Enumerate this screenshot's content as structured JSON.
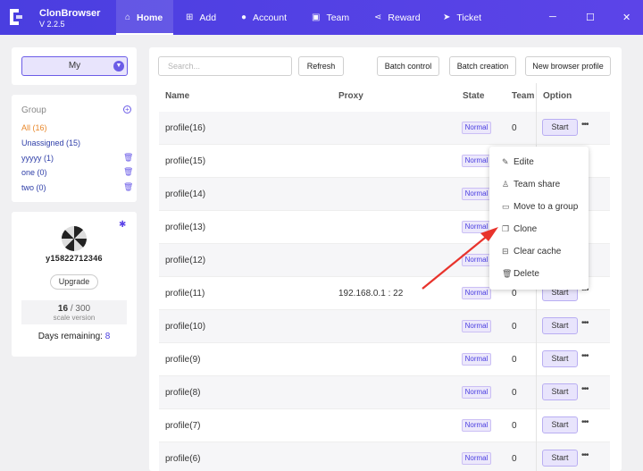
{
  "app": {
    "title": "ClonBrowser",
    "version": "V 2.2.5"
  },
  "nav": [
    {
      "label": "Home",
      "icon": "home-icon",
      "active": true
    },
    {
      "label": "Add",
      "icon": "plus-icon"
    },
    {
      "label": "Account",
      "icon": "account-icon"
    },
    {
      "label": "Team",
      "icon": "team-icon"
    },
    {
      "label": "Reward",
      "icon": "share-icon"
    },
    {
      "label": "Ticket",
      "icon": "send-icon"
    }
  ],
  "window_controls": {
    "minimize": "─",
    "maximize": "☐",
    "close": "✕"
  },
  "sidebar": {
    "selector_label": "My",
    "group_title": "Group",
    "groups": [
      {
        "name": "All",
        "count": "(16)"
      },
      {
        "name": "Unassigned",
        "count": "(15)"
      },
      {
        "name": "yyyyy",
        "count": "(1)"
      },
      {
        "name": "one",
        "count": "(0)"
      },
      {
        "name": "two",
        "count": "(0)"
      }
    ],
    "username": "y15822712346",
    "upgrade_label": "Upgrade",
    "quota_used": "16",
    "quota_sep": " / ",
    "quota_total": "300",
    "quota_label": "scale version",
    "days_label": "Days remaining: ",
    "days_value": "8"
  },
  "toolbar": {
    "search_placeholder": "Search...",
    "refresh": "Refresh",
    "batch_control": "Batch control",
    "batch_creation": "Batch creation",
    "new_profile": "New browser profile"
  },
  "table": {
    "columns": [
      "Name",
      "Proxy",
      "State",
      "Team",
      "Option"
    ],
    "rows": [
      {
        "name": "profile(16)",
        "proxy": "",
        "state": "Normal",
        "team": "0",
        "start": "Start"
      },
      {
        "name": "profile(15)",
        "proxy": "",
        "state": "Normal",
        "team": "",
        "start": ""
      },
      {
        "name": "profile(14)",
        "proxy": "",
        "state": "Normal",
        "team": "",
        "start": ""
      },
      {
        "name": "profile(13)",
        "proxy": "",
        "state": "Normal",
        "team": "",
        "start": ""
      },
      {
        "name": "profile(12)",
        "proxy": "",
        "state": "Normal",
        "team": "",
        "start": ""
      },
      {
        "name": "profile(11)",
        "proxy": "192.168.0.1 : 22",
        "state": "Normal",
        "team": "0",
        "start": "Start"
      },
      {
        "name": "profile(10)",
        "proxy": "",
        "state": "Normal",
        "team": "0",
        "start": "Start"
      },
      {
        "name": "profile(9)",
        "proxy": "",
        "state": "Normal",
        "team": "0",
        "start": "Start"
      },
      {
        "name": "profile(8)",
        "proxy": "",
        "state": "Normal",
        "team": "0",
        "start": "Start"
      },
      {
        "name": "profile(7)",
        "proxy": "",
        "state": "Normal",
        "team": "0",
        "start": "Start"
      },
      {
        "name": "profile(6)",
        "proxy": "",
        "state": "Normal",
        "team": "0",
        "start": "Start"
      }
    ]
  },
  "context_menu": [
    {
      "label": "Edite",
      "icon": "edit-icon"
    },
    {
      "label": "Team share",
      "icon": "user-icon"
    },
    {
      "label": "Move to a group",
      "icon": "folder-icon"
    },
    {
      "label": "Clone",
      "icon": "copy-icon"
    },
    {
      "label": "Clear cache",
      "icon": "broom-icon"
    },
    {
      "label": "Delete",
      "icon": "trash-icon"
    }
  ],
  "colors": {
    "accent": "#5c44e8",
    "badge_bg": "#ece8fb",
    "arrow": "#e8332c"
  }
}
